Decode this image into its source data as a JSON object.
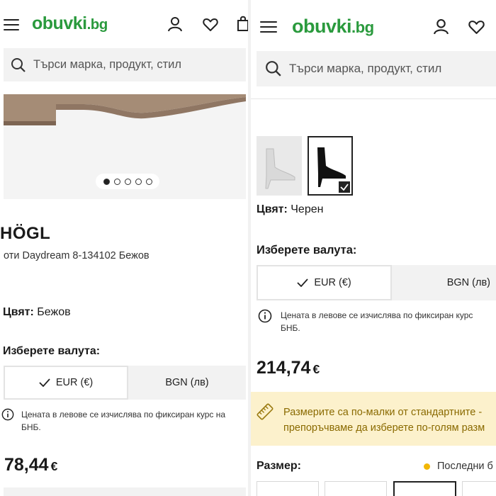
{
  "header": {
    "logo_main": "obuvki",
    "logo_tld": ".bg"
  },
  "search": {
    "placeholder": "Търси марка, продукт, стил"
  },
  "left": {
    "brand": "HÖGL",
    "product_name": "оти Daydream 8-134102 Бежов",
    "color_label": "Цвят:",
    "color_value": "Бежов",
    "currency_title": "Изберете валута:",
    "currency_eur": "EUR (€)",
    "currency_bgn": "BGN (лв)",
    "info_text_1": "Цената в левове се изчислява по фиксиран курс на",
    "info_text_2": "БНБ.",
    "price": "78,44",
    "price_currency": "€",
    "gallery_dots": 5,
    "gallery_active_dot": 1
  },
  "right": {
    "color_label": "Цвят:",
    "color_value": "Черен",
    "currency_title": "Изберете валута:",
    "currency_eur": "EUR (€)",
    "currency_bgn": "BGN (лв)",
    "info_text_1": "Цената в левове се изчислява по фиксиран курс",
    "info_text_2": "БНБ.",
    "price": "214,74",
    "price_currency": "€",
    "notice_line_1": "Размерите са по-малки от стандартните -",
    "notice_line_2": "препоръчваме да изберете по-голям разм",
    "size_title": "Размер:",
    "stock_text": "Последни б"
  },
  "colors": {
    "brand_green": "#2a9a3d",
    "notice_bg": "#fcf1cc",
    "notice_text": "#8a6a00",
    "stock_dot": "#f2b705"
  },
  "icons": [
    "menu-icon",
    "user-icon",
    "heart-icon",
    "bag-icon",
    "search-icon",
    "check-icon",
    "info-icon",
    "ruler-icon"
  ]
}
